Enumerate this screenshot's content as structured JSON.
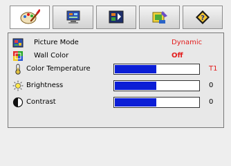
{
  "tabs": [
    {
      "icon": "paint-palette-icon",
      "active": true
    },
    {
      "icon": "monitor-icon",
      "active": false
    },
    {
      "icon": "settings-panel-icon",
      "active": false
    },
    {
      "icon": "wizard-icon",
      "active": false
    },
    {
      "icon": "help-diamond-icon",
      "active": false
    }
  ],
  "menu": {
    "picture_mode": {
      "label": "Picture Mode",
      "value": "Dynamic",
      "icon": "picture-icon"
    },
    "wall_color": {
      "label": "Wall Color",
      "value": "Off",
      "icon": "color-squares-icon"
    },
    "color_temperature": {
      "label": "Color Temperature",
      "value": "T1",
      "level": 0.5,
      "icon": "thermometer-icon"
    },
    "brightness": {
      "label": "Brightness",
      "value": "0",
      "level": 0.5,
      "icon": "sun-icon"
    },
    "contrast": {
      "label": "Contrast",
      "value": "0",
      "level": 0.5,
      "icon": "contrast-icon"
    }
  },
  "colors": {
    "accent": "#e31b1b",
    "bar_fill": "#0b1ed6"
  }
}
